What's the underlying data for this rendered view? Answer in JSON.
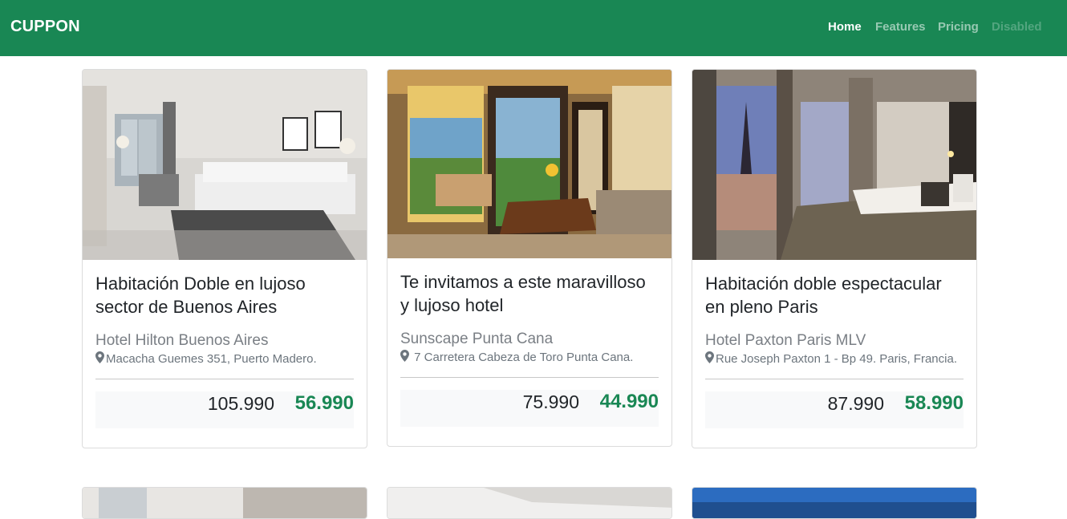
{
  "navbar": {
    "brand": "CUPPON",
    "links": [
      {
        "label": "Home",
        "state": "active"
      },
      {
        "label": "Features",
        "state": "normal"
      },
      {
        "label": "Pricing",
        "state": "normal"
      },
      {
        "label": "Disabled",
        "state": "disabled"
      }
    ]
  },
  "colors": {
    "brand_green": "#198754",
    "price_green": "#198754",
    "price_box_bg": "#f8f9fa"
  },
  "cards": [
    {
      "title": "Habitación Doble en lujoso sector de Buenos Aires",
      "hotel": "Hotel Hilton Buenos Aires",
      "address": "Macacha Guemes 351, Puerto Madero.",
      "old_price": "105.990",
      "new_price": "56.990",
      "icon": "map-marker-icon"
    },
    {
      "title": "Te invitamos a este maravilloso y lujoso hotel",
      "hotel": "Sunscape Punta Cana",
      "address": " 7 Carretera Cabeza de Toro Punta Cana.",
      "old_price": "75.990",
      "new_price": "44.990",
      "icon": "map-marker-icon"
    },
    {
      "title": "Habitación doble espectacular en pleno Paris",
      "hotel": "Hotel Paxton Paris MLV",
      "address": "Rue Joseph Paxton 1 - Bp 49. Paris, Francia.",
      "old_price": "87.990",
      "new_price": "58.990",
      "icon": "map-marker-icon"
    }
  ]
}
